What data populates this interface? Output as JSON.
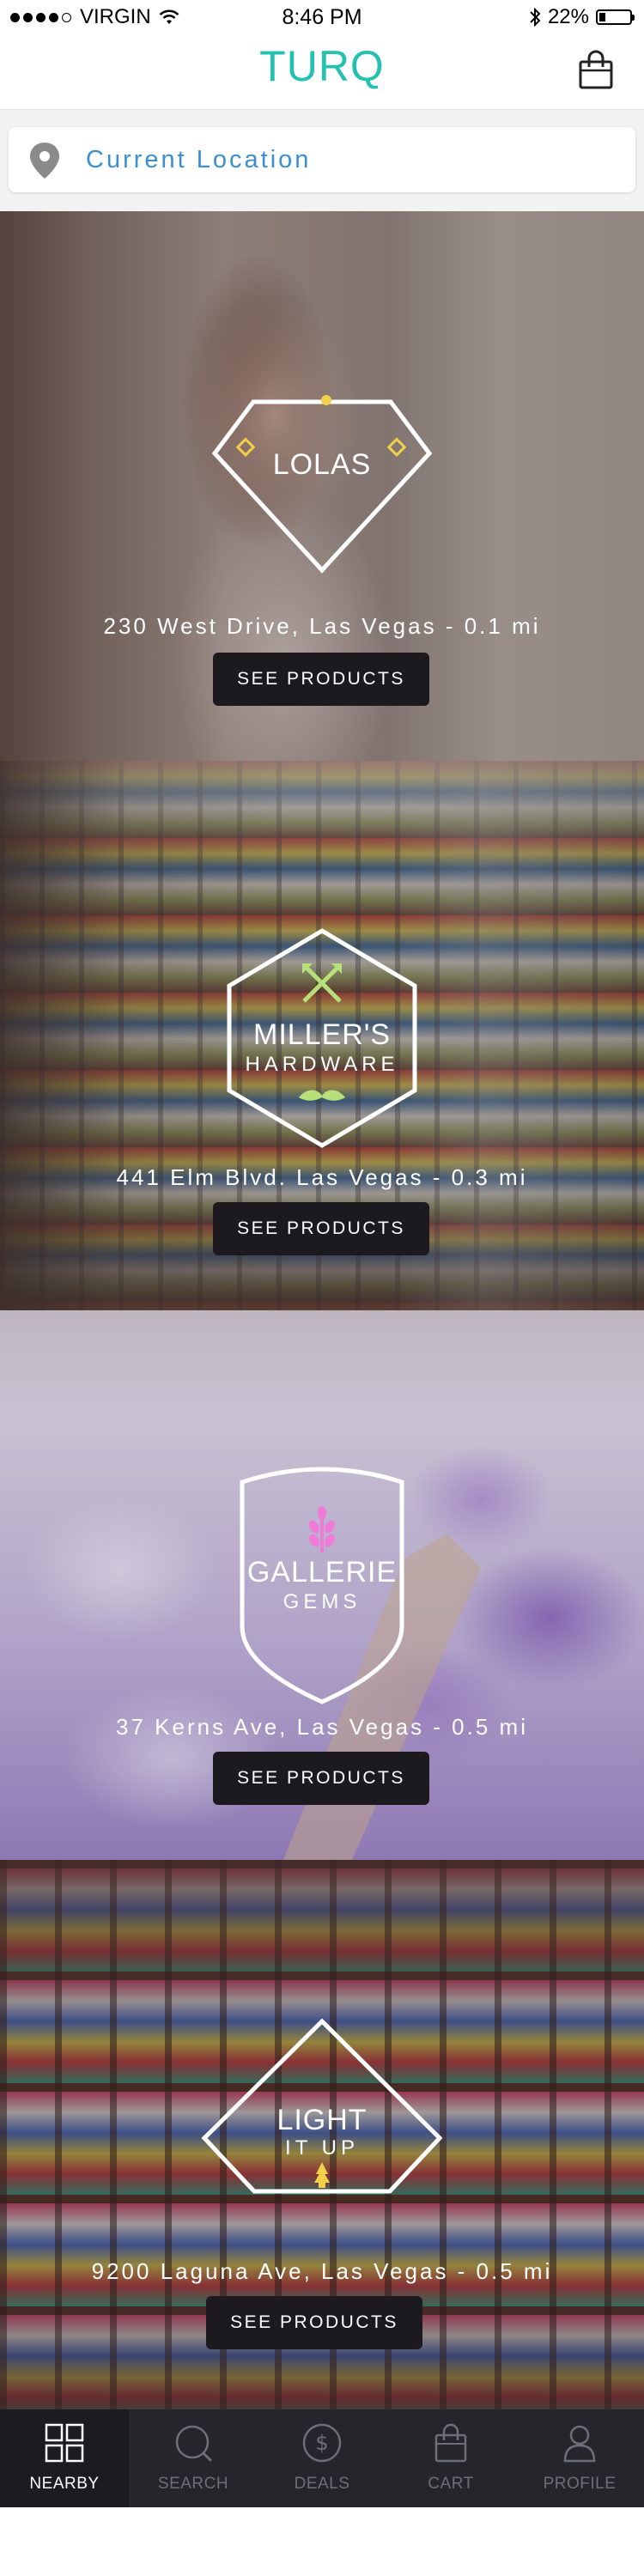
{
  "status_bar": {
    "carrier": "VIRGIN",
    "time": "8:46 PM",
    "battery": "22%",
    "battery_level": 0.22,
    "signal_bars": 4
  },
  "header": {
    "title": "TURQ",
    "brand_color": "#22c1b0",
    "right_icon": "shopping-bag-icon"
  },
  "location": {
    "icon": "location-pin-icon",
    "label": "Current Location"
  },
  "stores": [
    {
      "name": "LOLAS",
      "subtitle": "",
      "address": "230 West Drive, Las Vegas - 0.1 mi",
      "button": "SEE PRODUCTS",
      "logo_shape": "diamond"
    },
    {
      "name": "MILLER'S",
      "subtitle": "HARDWARE",
      "address": "441 Elm Blvd. Las Vegas - 0.3 mi",
      "button": "SEE PRODUCTS",
      "logo_shape": "hexagon"
    },
    {
      "name": "GALLERIE",
      "subtitle": "GEMS",
      "address": "37 Kerns Ave, Las Vegas - 0.5 mi",
      "button": "SEE PRODUCTS",
      "logo_shape": "shield"
    },
    {
      "name": "LIGHT",
      "subtitle": "IT UP",
      "address": "9200 Laguna Ave, Las Vegas - 0.5 mi",
      "button": "SEE PRODUCTS",
      "logo_shape": "diamond"
    }
  ],
  "tab_bar": {
    "tabs": [
      {
        "label": "NEARBY",
        "icon": "grid-icon",
        "active": true
      },
      {
        "label": "SEARCH",
        "icon": "search-icon",
        "active": false
      },
      {
        "label": "DEALS",
        "icon": "dollar-icon",
        "active": false
      },
      {
        "label": "CART",
        "icon": "shopping-bag-icon",
        "active": false
      },
      {
        "label": "PROFILE",
        "icon": "profile-icon",
        "active": false
      }
    ]
  }
}
